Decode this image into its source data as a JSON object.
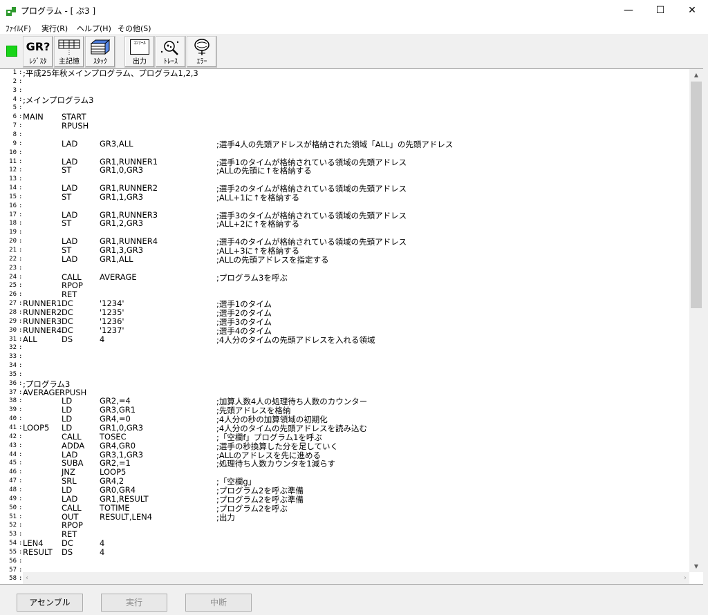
{
  "window": {
    "title": "プログラム - [ ぷ3 ]",
    "min": "—",
    "max": "☐",
    "close": "✕"
  },
  "menu": [
    "ﾌｧｲﾙ(F)",
    "実行(R)",
    "ヘルプ(H)",
    "その他(S)"
  ],
  "toolbar": [
    {
      "label": "ﾚｼﾞｽﾀ",
      "icon": "GR?"
    },
    {
      "label": "主記憶",
      "icon": "grid-icon"
    },
    {
      "label": "ｽﾀｯｸ",
      "icon": "stack-icon"
    },
    {
      "label": "出力",
      "icon": "ｺﾝｿｰﾙ"
    },
    {
      "label": "ﾄﾚｰｽ",
      "icon": "trace-icon"
    },
    {
      "label": "ｴﾗｰ",
      "icon": "error-icon"
    }
  ],
  "line_numbers": [
    "1",
    "2",
    "3",
    "4",
    "5",
    "6",
    "7",
    "8",
    "9",
    "10",
    "11",
    "12",
    "13",
    "14",
    "15",
    "16",
    "17",
    "18",
    "19",
    "20",
    "21",
    "22",
    "23",
    "24",
    "25",
    "26",
    "27",
    "28",
    "29",
    "30",
    "31",
    "32",
    "33",
    "34",
    "35",
    "36",
    "37",
    "38",
    "39",
    "40",
    "41",
    "42",
    "43",
    "44",
    "45",
    "46",
    "47",
    "48",
    "49",
    "50",
    "51",
    "52",
    "53",
    "54",
    "55",
    "56",
    "57",
    "58"
  ],
  "code": [
    {
      "n": 1,
      "text": ";平成25年秋メインプログラム、プログラム1,2,3"
    },
    {
      "n": 4,
      "text": ";メインプログラム3"
    },
    {
      "n": 6,
      "l": "MAIN",
      "o": "START"
    },
    {
      "n": 7,
      "o": "RPUSH"
    },
    {
      "n": 9,
      "o": "LAD",
      "a": "GR3,ALL",
      "c": ";選手4人の先頭アドレスが格納された領域「ALL」の先頭アドレス"
    },
    {
      "n": 11,
      "o": "LAD",
      "a": "GR1,RUNNER1",
      "c": ";選手1のタイムが格納されている領域の先頭アドレス"
    },
    {
      "n": 12,
      "o": "ST",
      "a": "GR1,0,GR3",
      "c": ";ALLの先頭に↑を格納する"
    },
    {
      "n": 14,
      "o": "LAD",
      "a": "GR1,RUNNER2",
      "c": ";選手2のタイムが格納されている領域の先頭アドレス"
    },
    {
      "n": 15,
      "o": "ST",
      "a": "GR1,1,GR3",
      "c": ";ALL+1に↑を格納する"
    },
    {
      "n": 17,
      "o": "LAD",
      "a": "GR1,RUNNER3",
      "c": ";選手3のタイムが格納されている領域の先頭アドレス"
    },
    {
      "n": 18,
      "o": "ST",
      "a": "GR1,2,GR3",
      "c": ";ALL+2に↑を格納する"
    },
    {
      "n": 20,
      "o": "LAD",
      "a": "GR1,RUNNER4",
      "c": ";選手4のタイムが格納されている領域の先頭アドレス"
    },
    {
      "n": 21,
      "o": "ST",
      "a": "GR1,3,GR3",
      "c": ";ALL+3に↑を格納する"
    },
    {
      "n": 22,
      "o": "LAD",
      "a": "GR1,ALL",
      "c": ";ALLの先頭アドレスを指定する"
    },
    {
      "n": 24,
      "o": "CALL",
      "a": "AVERAGE",
      "c": ";プログラム3を呼ぶ"
    },
    {
      "n": 25,
      "o": "RPOP"
    },
    {
      "n": 26,
      "o": "RET"
    },
    {
      "n": 27,
      "l": "RUNNER1",
      "o": "DC",
      "a": "'1234'",
      "c": ";選手1のタイム"
    },
    {
      "n": 28,
      "l": "RUNNER2",
      "o": "DC",
      "a": "'1235'",
      "c": ";選手2のタイム"
    },
    {
      "n": 29,
      "l": "RUNNER3",
      "o": "DC",
      "a": "'1236'",
      "c": ";選手3のタイム"
    },
    {
      "n": 30,
      "l": "RUNNER4",
      "o": "DC",
      "a": "'1237'",
      "c": ";選手4のタイム"
    },
    {
      "n": 31,
      "l": "ALL",
      "o": "DS",
      "a": "4",
      "c": ";4人分のタイムの先頭アドレスを入れる領域"
    },
    {
      "n": 36,
      "text": ";プログラム3"
    },
    {
      "n": 37,
      "l": "AVERAGE",
      "o": "RPUSH",
      "tight": true
    },
    {
      "n": 38,
      "o": "LD",
      "a": "GR2,=4",
      "c": ";加算人数4人の処理待ち人数のカウンター"
    },
    {
      "n": 39,
      "o": "LD",
      "a": "GR3,GR1",
      "c": ";先頭アドレスを格納"
    },
    {
      "n": 40,
      "o": "LD",
      "a": "GR4,=0",
      "c": ";4人分の秒の加算領域の初期化"
    },
    {
      "n": 41,
      "l": "LOOP5",
      "o": "LD",
      "a": "GR1,0,GR3",
      "c": ";4人分のタイムの先頭アドレスを読み込む"
    },
    {
      "n": 42,
      "o": "CALL",
      "a": "TOSEC",
      "c": ";「空欄f」プログラム1を呼ぶ"
    },
    {
      "n": 43,
      "o": "ADDA",
      "a": "GR4,GR0",
      "c": ";選手の秒換算した分を足していく"
    },
    {
      "n": 44,
      "o": "LAD",
      "a": "GR3,1,GR3",
      "c": ";ALLのアドレスを先に進める"
    },
    {
      "n": 45,
      "o": "SUBA",
      "a": "GR2,=1",
      "c": ";処理待ち人数カウンタを1減らす"
    },
    {
      "n": 46,
      "o": "JNZ",
      "a": "LOOP5"
    },
    {
      "n": 47,
      "o": "SRL",
      "a": "GR4,2",
      "c": ";「空欄g」"
    },
    {
      "n": 48,
      "o": "LD",
      "a": "GR0,GR4",
      "c": ";プログラム2を呼ぶ準備"
    },
    {
      "n": 49,
      "o": "LAD",
      "a": "GR1,RESULT",
      "c": ";プログラム2を呼ぶ準備"
    },
    {
      "n": 50,
      "o": "CALL",
      "a": "TOTIME",
      "c": ";プログラム2を呼ぶ"
    },
    {
      "n": 51,
      "o": "OUT",
      "a": "RESULT,LEN4",
      "c": ";出力"
    },
    {
      "n": 52,
      "o": "RPOP"
    },
    {
      "n": 53,
      "o": "RET"
    },
    {
      "n": 54,
      "l": "LEN4",
      "o": "DC",
      "a": "4"
    },
    {
      "n": 55,
      "l": "RESULT",
      "o": "DS",
      "a": "4"
    }
  ],
  "buttons": {
    "assemble": "アセンブル",
    "run": "実行",
    "stop": "中断"
  }
}
